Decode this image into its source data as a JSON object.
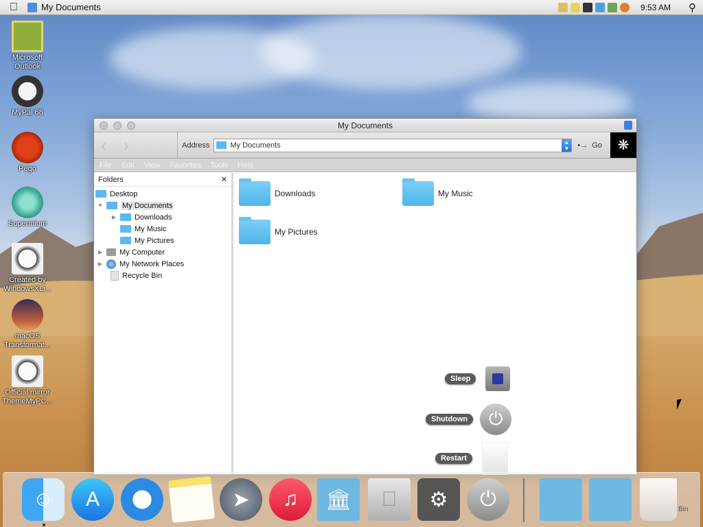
{
  "menubar": {
    "apple": "",
    "window_title": "My Documents",
    "clock": "9:53 AM"
  },
  "desktop_icons": [
    {
      "label": "Microsoft Outlook"
    },
    {
      "label": "MyPal 68"
    },
    {
      "label": "Pego"
    },
    {
      "label": "Supermium"
    },
    {
      "label": "Created by WindowsXLi..."
    },
    {
      "label": "macOS Transformat..."
    },
    {
      "label": "Official mirror ThemeMyPC..."
    }
  ],
  "window": {
    "title": "My Documents",
    "address_label": "Address",
    "address_value": "My Documents",
    "go_label": "Go",
    "menus": [
      "File",
      "Edit",
      "View",
      "Favorites",
      "Tools",
      "Help"
    ],
    "folders_title": "Folders",
    "close_glyph": "✕",
    "tree": [
      {
        "label": "Desktop"
      },
      {
        "label": "My Documents"
      },
      {
        "label": "Downloads"
      },
      {
        "label": "My Music"
      },
      {
        "label": "My Pictures"
      },
      {
        "label": "My Computer"
      },
      {
        "label": "My Network Places"
      },
      {
        "label": "Recycle Bin"
      }
    ],
    "items": [
      {
        "label": "Downloads"
      },
      {
        "label": "My Music"
      },
      {
        "label": "My Pictures"
      }
    ]
  },
  "power": {
    "sleep": "Sleep",
    "shutdown": "Shutdown",
    "restart": "Restart"
  },
  "dock": {
    "bin_label": "Bin"
  },
  "colors": {
    "folder_blue": "#5cb8ef",
    "pill_gray": "#5a5a5a"
  }
}
